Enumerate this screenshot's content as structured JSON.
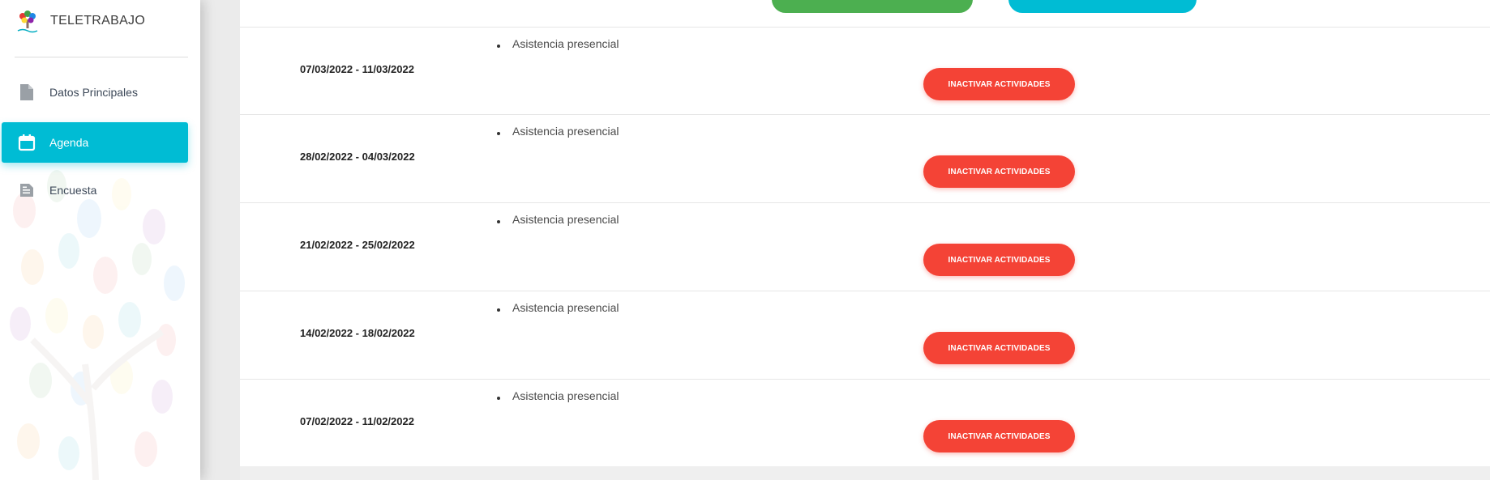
{
  "app": {
    "title": "TELETRABAJO"
  },
  "sidebar": {
    "items": [
      {
        "label": "Datos Principales",
        "icon": "document-icon",
        "active": false
      },
      {
        "label": "Agenda",
        "icon": "calendar-icon",
        "active": true
      },
      {
        "label": "Encuesta",
        "icon": "note-icon",
        "active": false
      }
    ]
  },
  "weeks": [
    {
      "range": "07/03/2022 - 11/03/2022",
      "activity": "Asistencia presencial",
      "button": "INACTIVAR ACTIVIDADES"
    },
    {
      "range": "28/02/2022 - 04/03/2022",
      "activity": "Asistencia presencial",
      "button": "INACTIVAR ACTIVIDADES"
    },
    {
      "range": "21/02/2022 - 25/02/2022",
      "activity": "Asistencia presencial",
      "button": "INACTIVAR ACTIVIDADES"
    },
    {
      "range": "14/02/2022 - 18/02/2022",
      "activity": "Asistencia presencial",
      "button": "INACTIVAR ACTIVIDADES"
    },
    {
      "range": "07/02/2022 - 11/02/2022",
      "activity": "Asistencia presencial",
      "button": "INACTIVAR ACTIVIDADES"
    }
  ],
  "colors": {
    "accent": "#00bcd4",
    "success": "#4caf50",
    "danger": "#f44336"
  }
}
